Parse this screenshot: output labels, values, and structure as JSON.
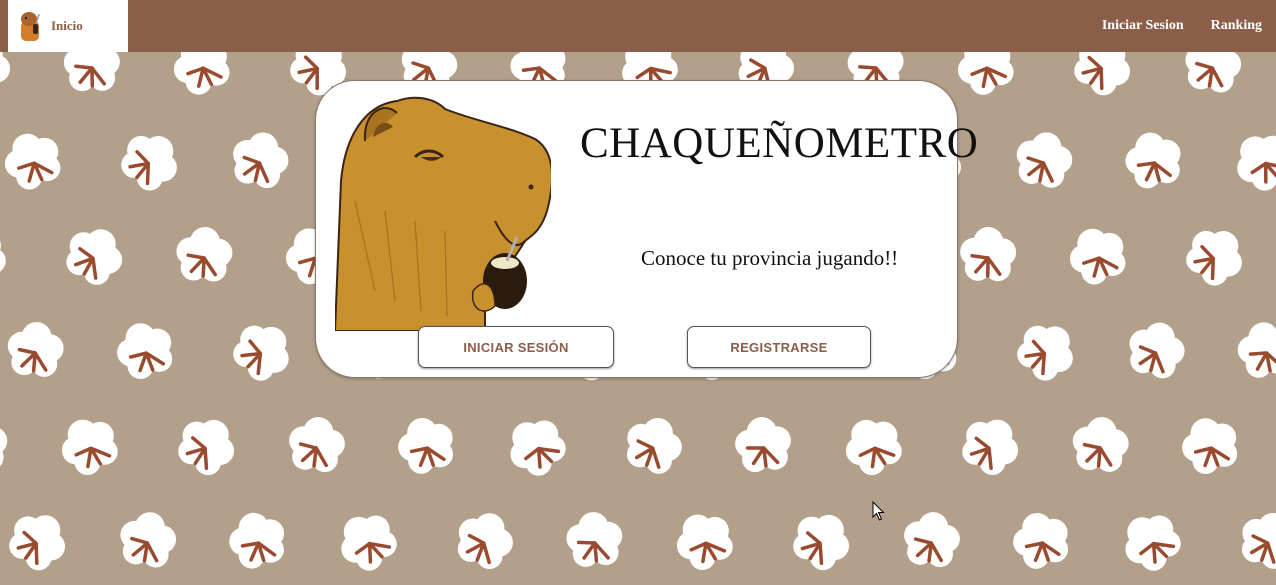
{
  "nav": {
    "home_label": "Inicio",
    "links": [
      "Iniciar Sesion",
      "Ranking"
    ]
  },
  "hero": {
    "title": "CHAQUEÑOMETRO",
    "subtitle": "Conoce tu provincia jugando!!",
    "login_button": "INICIAR SESIÓN",
    "register_button": "REGISTRARSE"
  },
  "icons": {
    "logo": "capybara-logo-icon",
    "illustration": "capybara-drinking-mate-illustration",
    "background": "cotton-flower-pattern",
    "pointer": "mouse-cursor-icon"
  },
  "colors": {
    "navbar": "#8b5e49",
    "background": "#b3a08a",
    "accent_text": "#8b5e49",
    "cotton": "#ffffff",
    "cotton_stem": "#9a4a2e",
    "capybara": "#c9902e"
  }
}
